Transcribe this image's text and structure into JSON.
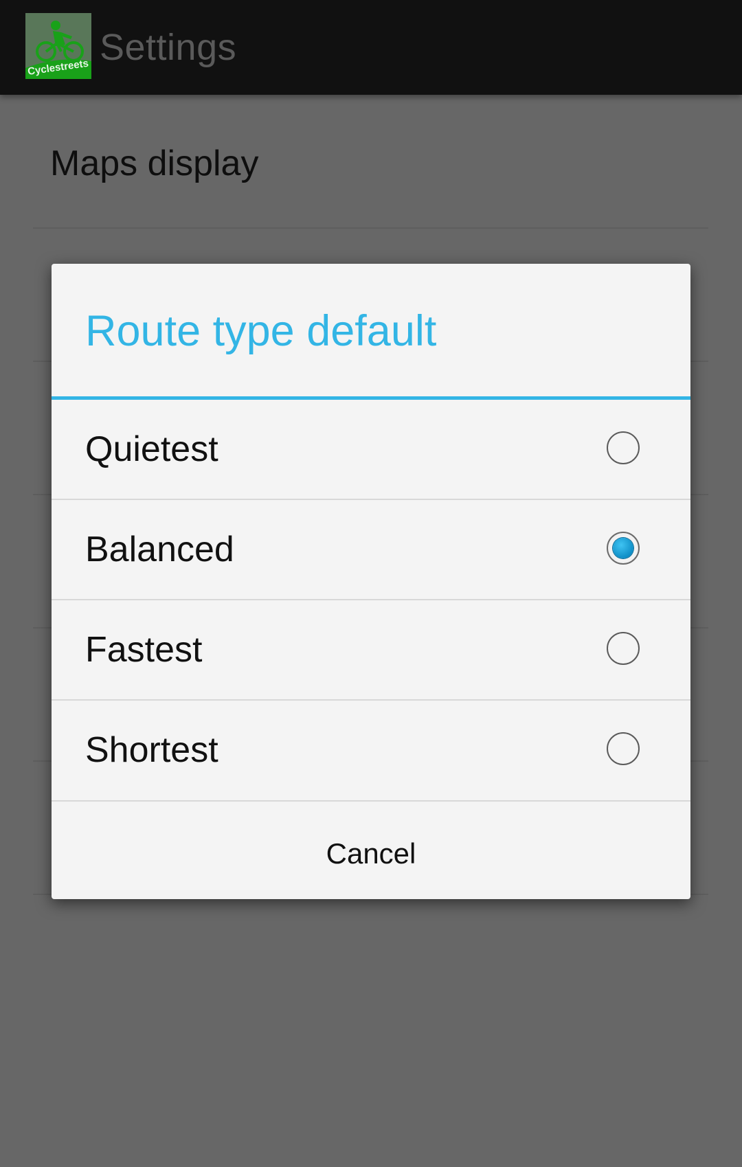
{
  "app": {
    "title": "Settings",
    "logo_text": "Cyclestreets",
    "logo_icon": "cyclist-logo-icon"
  },
  "preferences": {
    "first_item": "Maps display"
  },
  "dialog": {
    "title": "Route type default",
    "accent_color": "#33b5e5",
    "options": [
      {
        "label": "Quietest",
        "selected": false
      },
      {
        "label": "Balanced",
        "selected": true
      },
      {
        "label": "Fastest",
        "selected": false
      },
      {
        "label": "Shortest",
        "selected": false
      }
    ],
    "cancel_label": "Cancel"
  }
}
